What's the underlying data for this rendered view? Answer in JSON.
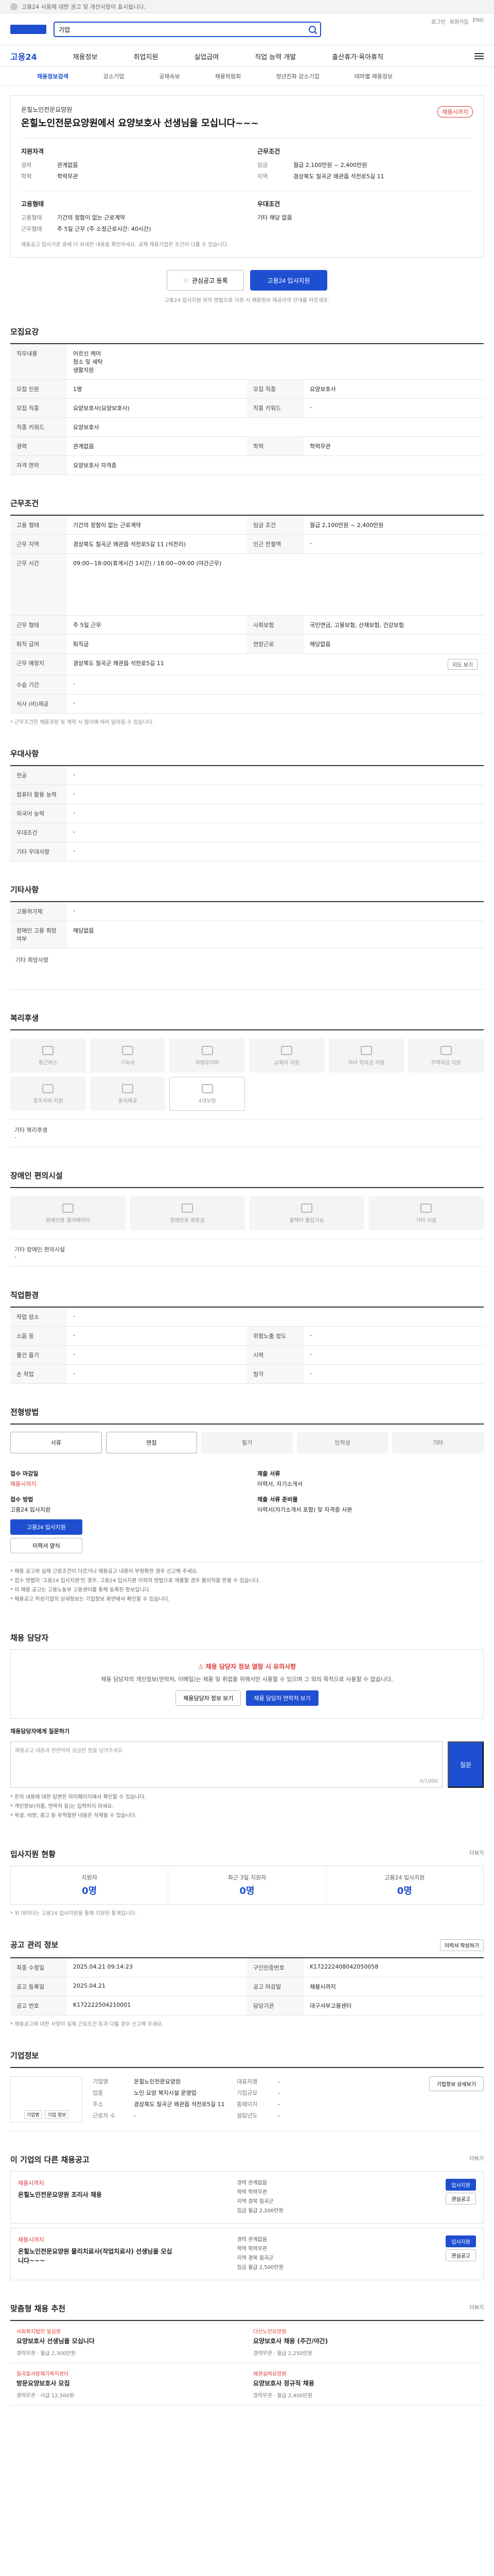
{
  "topbar": {
    "notice": "고용24 사용에 대한 권고 및 개선사항이 표시됩니다."
  },
  "header": {
    "search_value": "기업",
    "links": [
      "로그인",
      "회원가입",
      "ENG"
    ]
  },
  "nav": {
    "brand": "고용24",
    "items": [
      "채용정보",
      "취업지원",
      "실업급여",
      "직업 능력 개발",
      "출산휴가·육아휴직"
    ]
  },
  "subtabs": [
    "채용정보검색",
    "강소기업",
    "공채속보",
    "채용박람회",
    "청년친화 강소기업",
    "테마별 채용정보"
  ],
  "jobhead": {
    "company": "온힐노인전문요양원",
    "title": "온힐노인전문요양원에서 요양보호사 선생님을 모십니다~~~",
    "status": "채용시까지",
    "qual_title": "지원자격",
    "qual": [
      {
        "k": "경력",
        "v": "관계없음"
      },
      {
        "k": "학력",
        "v": "학력무관"
      }
    ],
    "cond_title": "근무조건",
    "cond": [
      {
        "k": "임금",
        "v": "월급 2,100만원 ~ 2,400만원"
      },
      {
        "k": "지역",
        "v": "경상북도 칠곡군 왜관읍 석전로5길 11"
      }
    ],
    "emp_title": "고용형태",
    "emp": [
      {
        "k": "고용형태",
        "v": "기간의 정함이 없는 근로계약"
      },
      {
        "k": "근무형태",
        "v": "주 5일 근무 (주 소정근로시간: 40시간)"
      }
    ],
    "etc_title": "우대조건",
    "etc": [
      {
        "k": "",
        "v": "기타 해당 없음"
      }
    ],
    "note": "채용공고 임시기준 중에 더 자세한 내용을 확인하세요. 공채 채용기업은 조건이 다를 수 있습니다."
  },
  "actions": {
    "scrap": "관심공고 등록",
    "apply": "고용24 입사지원",
    "note": "고용24 입사지원 외의 방법으로 지원 시 채용정보 제공자의 안내를 따르세요."
  },
  "recruit": {
    "title": "모집요강",
    "job_label": "직무내용",
    "job_desc": [
      "어르신 케어",
      "청소 및 세탁",
      "생활지원"
    ],
    "rows": [
      {
        "k": "모집 인원",
        "v": "1명",
        "k2": "모집 직종",
        "v2": "요양보호사"
      },
      {
        "k": "모집 직종",
        "v": "요양보호사(요양보호사)",
        "k2": "직종 키워드",
        "v2": "-"
      },
      {
        "k": "직종 키워드",
        "v": "요양보호사"
      },
      {
        "k": "경력",
        "v": "관계없음",
        "k2": "학력",
        "v2": "학력무관"
      },
      {
        "k": "자격 면허",
        "v": "요양보호사 자격증"
      }
    ]
  },
  "workcond": {
    "title": "근무조건",
    "rows": [
      {
        "k": "고용 형태",
        "v": "기간의 정함이 없는 근로계약",
        "k2": "임금 조건",
        "v2": "월급 2,100만원 ~ 2,400만원"
      },
      {
        "k": "근무 지역",
        "v": "경상북도 칠곡군 왜관읍 석전로5길 11 (석전리)",
        "k2": "인근 전철역",
        "v2": "-"
      },
      {
        "k": "근무 시간",
        "v": "09:00~18:00(휴게시간 1시간) / 18:00~09:00 (야간근무)"
      },
      {
        "k": "근무 형태",
        "v": "주 5일 근무",
        "k2": "사회보험",
        "v2": "국민연금, 고용보험, 산재보험, 건강보험"
      },
      {
        "k": "퇴직 급여",
        "v": "퇴직금",
        "k2": "연장근로",
        "v2": "해당없음"
      },
      {
        "k": "근무 예정지",
        "v": "경상북도 칠곡군 왜관읍 석전로5길 11"
      },
      {
        "k": "수습 기간",
        "v": "-"
      },
      {
        "k": "식사 (비)제공",
        "v": "-"
      }
    ],
    "note": "* 근무조건은 채용과정 및 계약 시 협의에 따라 달라질 수 있습니다."
  },
  "prefer": {
    "title": "우대사항",
    "rows": [
      {
        "k": "전공",
        "v": "-"
      },
      {
        "k": "컴퓨터 활용 능력",
        "v": "-"
      },
      {
        "k": "외국어 능력",
        "v": "-"
      },
      {
        "k": "우대조건",
        "v": "-"
      },
      {
        "k": "기타 우대사항",
        "v": "-"
      }
    ]
  },
  "other": {
    "title": "기타사항",
    "rows": [
      {
        "k": "고용허가제",
        "v": "-"
      },
      {
        "k": "장애인 고용 희망여부",
        "v": "해당없음"
      }
    ],
    "extra": "기타 희망사항"
  },
  "welfare": {
    "title": "복리후생",
    "items": [
      "통근버스",
      "기숙사",
      "차량유지비",
      "교육비 지원",
      "자녀 학자금 지원",
      "주택자금 지원",
      "경조사비 지원",
      "중식제공",
      "4대보험"
    ],
    "text_label": "기타 복리후생",
    "text": "-"
  },
  "disab": {
    "title": "장애인 편의시설",
    "items": [
      "장애인용 엘리베이터",
      "장애인용 화장실",
      "휠체어 출입가능",
      "기타 시설"
    ],
    "text_label": "기타 장애인 편의시설",
    "text": "-"
  },
  "workplace": {
    "title": "직업환경",
    "rows": [
      {
        "k": "작업 장소",
        "v": "-"
      },
      {
        "k": "소음 등",
        "v": "-",
        "k2": "위험노출 정도",
        "v2": "-"
      },
      {
        "k": "물건 들기",
        "v": "-",
        "k2": "시력",
        "v2": "-"
      },
      {
        "k": "손 작업",
        "v": "-",
        "k2": "청각",
        "v2": "-"
      }
    ]
  },
  "apply": {
    "title": "전형방법",
    "methods": [
      "서류",
      "면접",
      "필기",
      "인적성",
      "기타"
    ],
    "period_label": "접수 마감일",
    "period_value": "채용시까지",
    "apply_label": "접수 방법",
    "apply_value": "고용24 입사지원",
    "doc_label": "제출 서류",
    "doc_value": "이력서, 자기소개서",
    "way_label": "제출 서류 준비물",
    "way_value": "이력서(자기소개서 포함) 및 자격증 사본",
    "apply_btn": "고용24 입사지원",
    "print_btn": "이력서 양식",
    "bullets": [
      "* 채용 공고와 실제 근로조건이 다르거나 채용공고 내용이 부정확한 경우 신고해 주세요.",
      "* 접수 방법이 '고용24 입사지원'인 경우, 고용24 입사지원 이외의 방법으로 제출할 경우 불이익을 받을 수 있습니다.",
      "* 이 채용 공고는 고용노동부 고용센터를 통해 등록된 정보입니다.",
      "* 채용공고 작성기업의 상세정보는 기업정보 화면에서 확인할 수 있습니다."
    ]
  },
  "contact": {
    "title": "채용 담당자",
    "warn": "채용 담당자 정보 열람 시 유의사항",
    "text": "채용 담당자의 개인정보(연락처, 이메일)는 채용 및 취업을 위해서만 사용할 수 있으며 그 외의 목적으로 사용할 수 없습니다.",
    "btn1": "채용담당자 정보 보기",
    "btn2": "채용 담당자 연락처 보기",
    "qna_title": "채용담당자에게 질문하기",
    "qna_placeholder": "채용공고 내용과 관련하여 궁금한 점을 남겨주세요.",
    "qna_count": "0/1000",
    "qna_btn": "질문",
    "bullets": [
      "* 문의 내용에 대한 답변은 마이페이지에서 확인할 수 있습니다.",
      "* 개인정보(이름, 연락처 등)는 입력하지 마세요.",
      "* 욕설, 비방, 광고 등 부적절한 내용은 삭제될 수 있습니다."
    ]
  },
  "stats": {
    "title": "입사지원 현황",
    "link": "더보기",
    "items": [
      {
        "l": "지원자",
        "n": "0명"
      },
      {
        "l": "최근 3일 지원자",
        "n": "0명"
      },
      {
        "l": "고용24 입사지원",
        "n": "0명"
      }
    ],
    "note": "* 위 데이터는 고용24 입사지원을 통해 지원한 통계입니다."
  },
  "manage": {
    "title": "공고 관리 정보",
    "btn": "이력서 작성하기",
    "rows": [
      {
        "k": "최종 수정일",
        "v": "2025.04.21 09:14:23",
        "k2": "구인인증번호",
        "v2": "K172222408042050058"
      },
      {
        "k": "공고 등록일",
        "v": "2025.04.21",
        "k2": "공고 마감일",
        "v2": "채용시까지"
      },
      {
        "k": "공고 번호",
        "v": "K172222504210001",
        "k2": "담당기관",
        "v2": "대구서부고용센터"
      }
    ],
    "note": "* 채용공고에 대한 사항이 실제 근로조건 등과 다를 경우 신고해 주세요."
  },
  "company": {
    "title": "기업정보",
    "logo_btns": [
      "기업명",
      "기업 정보"
    ],
    "btn": "기업정보 상세보기",
    "rows": [
      {
        "k": "기업명",
        "v": "온힐노인전문요양원",
        "k2": "대표자명",
        "v2": "-"
      },
      {
        "k": "업종",
        "v": "노인 요양 복지시설 운영업",
        "k2": "기업규모",
        "v2": "-"
      },
      {
        "k": "주소",
        "v": "경상북도 칠곡군 왜관읍 석전로5길 11",
        "k2": "홈페이지",
        "v2": "-"
      },
      {
        "k": "근로자 수",
        "v": "-",
        "k2": "설립년도",
        "v2": "-"
      }
    ]
  },
  "others": {
    "title": "이 기업의 다른 채용공고",
    "link": "더보기",
    "items": [
      {
        "co": "채용시까지",
        "title": "온힐노인전문요양원 조리사 채용",
        "meta": [
          "경력 관계없음",
          "학력 학력무관",
          "지역 경북 칠곡군",
          "임금 월급 2,200만원"
        ],
        "btns": [
          "입사지원",
          "관심공고"
        ]
      },
      {
        "co": "채용시까지",
        "title": "온힐노인전문요양원 물리치료사(작업치료사) 선생님을 모십니다~~~",
        "meta": [
          "경력 관계없음",
          "학력 학력무관",
          "지역 경북 칠곡군",
          "임금 월급 2,500만원"
        ],
        "btns": [
          "입사지원",
          "관심공고"
        ]
      }
    ]
  },
  "reco": {
    "title": "맞춤형 채용 추천",
    "link": "더보기",
    "items": [
      {
        "co": "사회복지법인 일심원",
        "title": "요양보호사 선생님을 모십니다",
        "meta": "경력무관 · 월급 2,300만원"
      },
      {
        "co": "다산노인요양원",
        "title": "요양보호사 채용 (주간/야간)",
        "meta": "경력무관 · 월급 2,250만원"
      },
      {
        "co": "칠곡효사랑재가복지센터",
        "title": "방문요양보호사 모집",
        "meta": "경력무관 · 시급 12,500원"
      },
      {
        "co": "왜관실버요양원",
        "title": "요양보호사 정규직 채용",
        "meta": "경력무관 · 월급 2,400만원"
      }
    ]
  }
}
